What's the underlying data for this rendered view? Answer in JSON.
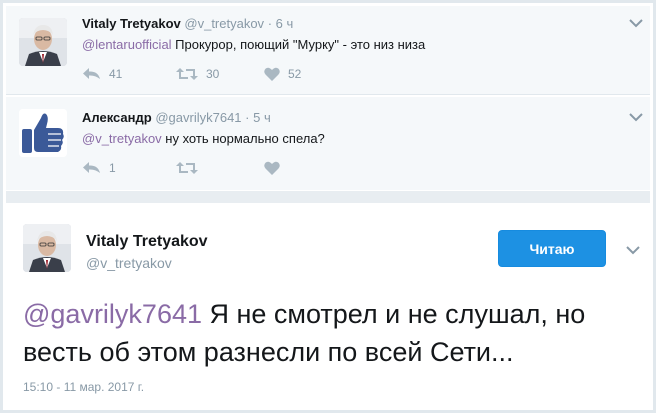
{
  "replies": [
    {
      "name": "Vitaly Tretyakov",
      "handle": "@v_tretyakov",
      "time": "· 6 ч",
      "mention": "@lentaruofficial",
      "text": " Прокурор, поющий \"Мурку\" - это низ низа",
      "avatar_icon": "profile-photo",
      "actions": {
        "reply_count": "41",
        "retweet_count": "30",
        "like_count": "52"
      }
    },
    {
      "name": "Александр",
      "handle": "@gavrilyk7641",
      "time": "· 5 ч",
      "mention": "@v_tretyakov",
      "text": " ну хоть нормально спела?",
      "avatar_icon": "thumbs-up-avatar",
      "actions": {
        "reply_count": "1"
      }
    }
  ],
  "main": {
    "name": "Vitaly Tretyakov",
    "handle": "@v_tretyakov",
    "follow_label": "Читаю",
    "mention": "@gavrilyk7641",
    "text": " Я не смотрел и не слушал, но весть об этом разнесли по всей Сети...",
    "timestamp": "15:10 - 11 мар. 2017 г."
  },
  "colors": {
    "accent": "#1d91e3",
    "mention": "#8a6ba6",
    "muted": "#8899a6",
    "reply_bg": "#f5f8fa"
  }
}
